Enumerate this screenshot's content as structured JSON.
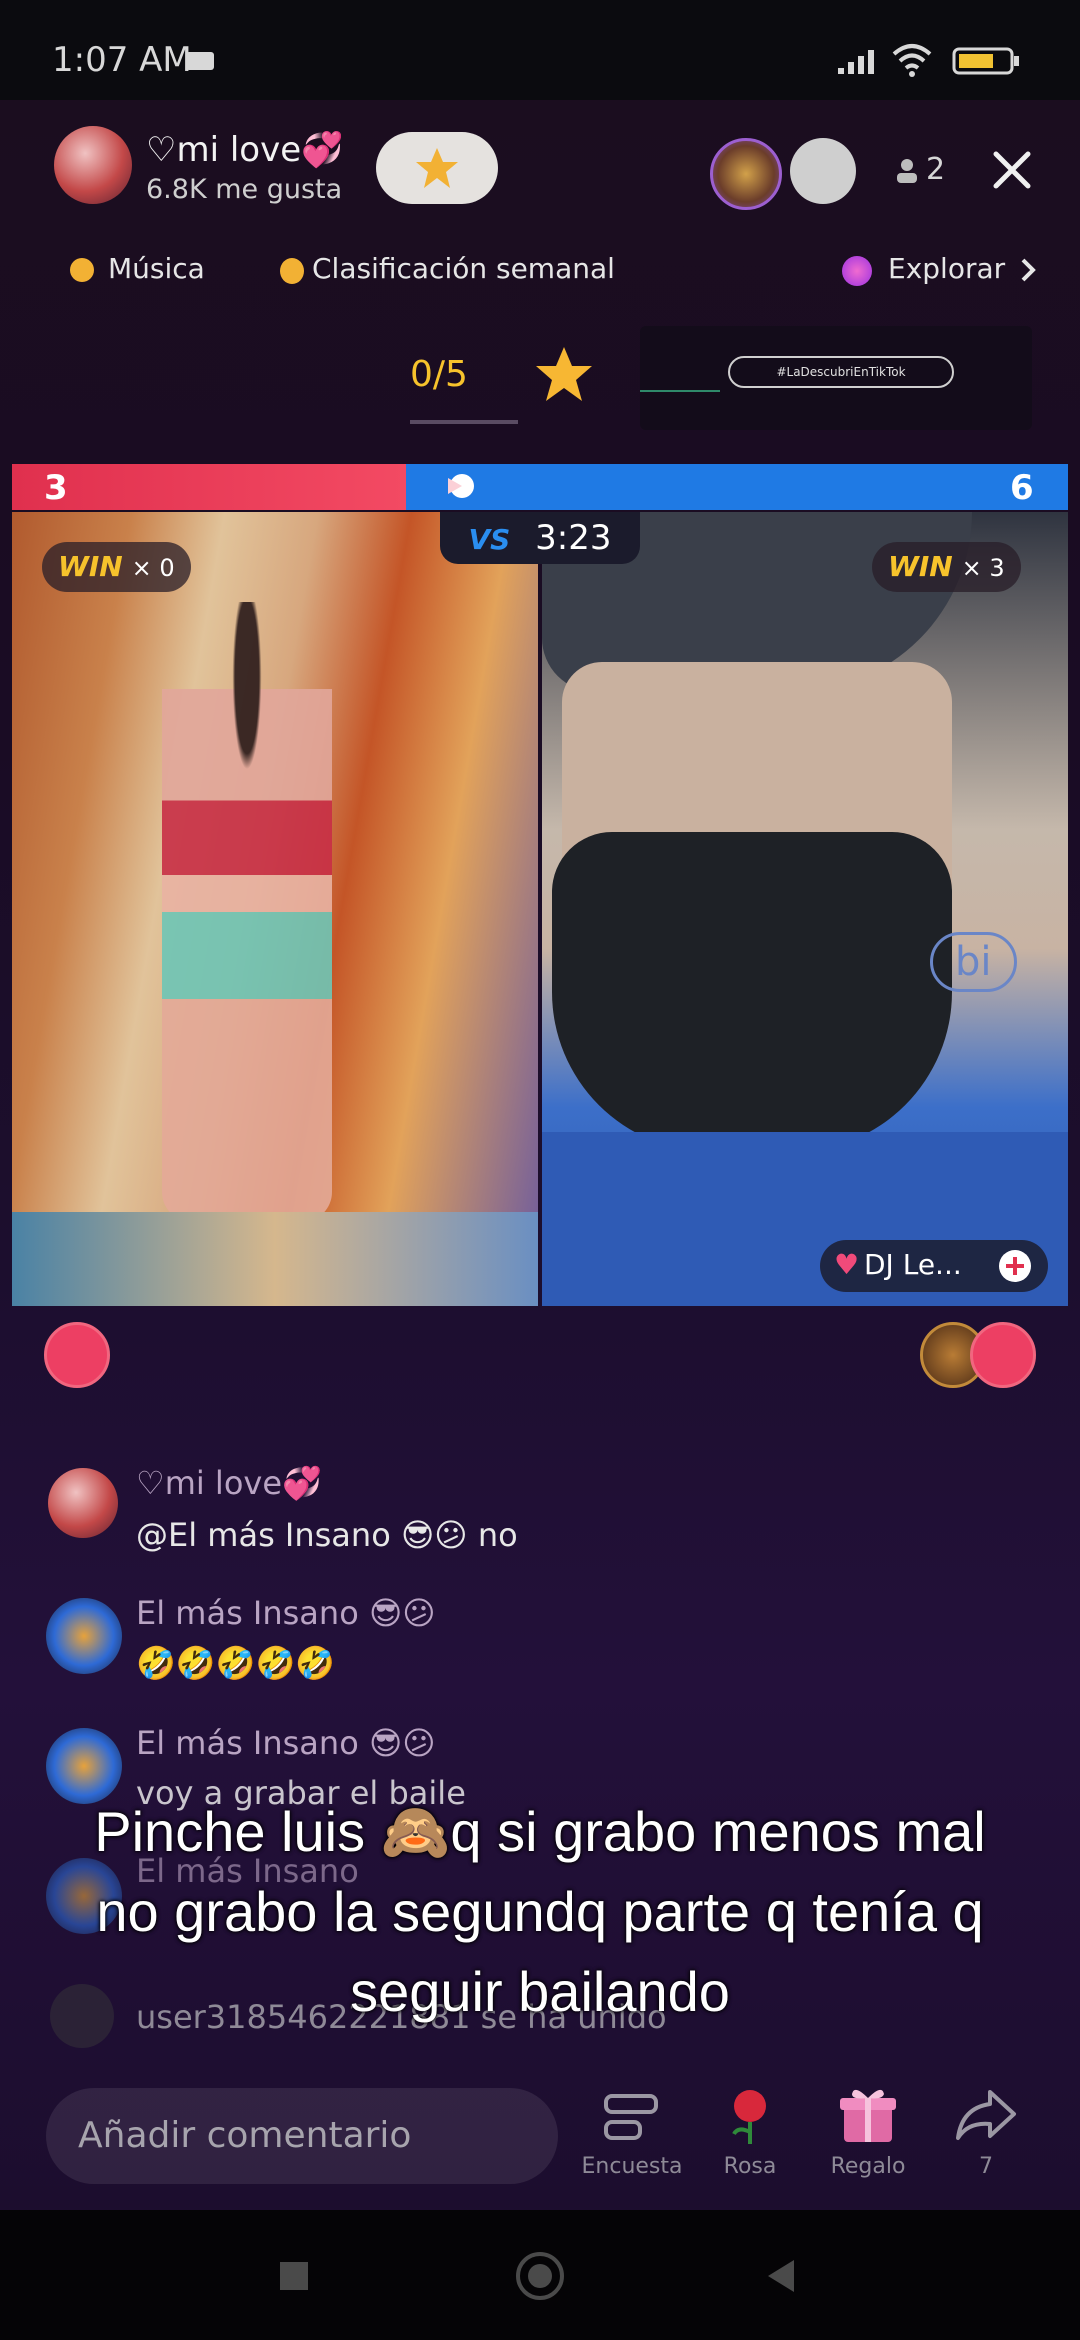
{
  "status_bar": {
    "time": "1:07 AM"
  },
  "host": {
    "name": "♡mi love💞",
    "likes": "6.8K me gusta"
  },
  "viewers": {
    "count": "2"
  },
  "topbar": {
    "music": "Música",
    "ranking": "Clasificación semanal",
    "explore": "Explorar"
  },
  "goal": {
    "progress": "0/5",
    "tag": "#LaDescubriEnTikTok"
  },
  "battle": {
    "score_left": "3",
    "score_right": "6",
    "red_fraction": 0.333,
    "timer": "3:23",
    "vs_label": "VS",
    "left_wins_word": "WIN",
    "left_wins": "× 0",
    "right_wins_word": "WIN",
    "right_wins": "× 3",
    "right_user": "DJ Le...",
    "right_bg_logo": "bi"
  },
  "chat": [
    {
      "name": "♡mi love💞",
      "text": "@El más Insano 😎😕 no"
    },
    {
      "name": "El más Insano 😎😕",
      "text": "🤣🤣🤣🤣🤣"
    },
    {
      "name": "El más Insano 😎😕",
      "text": "voy a grabar el baile"
    },
    {
      "name": "El más Insano",
      "text": ""
    },
    {
      "name": "",
      "text": "user3185462221881 se ha unido"
    }
  ],
  "subtitle": [
    "Pinche luis 🙈q si grabo menos mal",
    "no grabo la segundq parte q tenía q",
    "seguir bailando"
  ],
  "bottom": {
    "comment_placeholder": "Añadir comentario",
    "poll_label": "Encuesta",
    "rose_label": "Rosa",
    "gift_label": "Regalo",
    "share_count": "7"
  },
  "colors": {
    "red_team": "#e0304e",
    "blue_team": "#1f7ae4",
    "win_gold": "#f7c32c",
    "accent_pink": "#f04a7a"
  },
  "icons": [
    "signal-icon",
    "wifi-icon",
    "battery-icon",
    "close-icon",
    "person-icon",
    "star-icon",
    "poll-icon",
    "rose-icon",
    "gift-icon",
    "share-icon",
    "wave-icon",
    "add-icon"
  ]
}
